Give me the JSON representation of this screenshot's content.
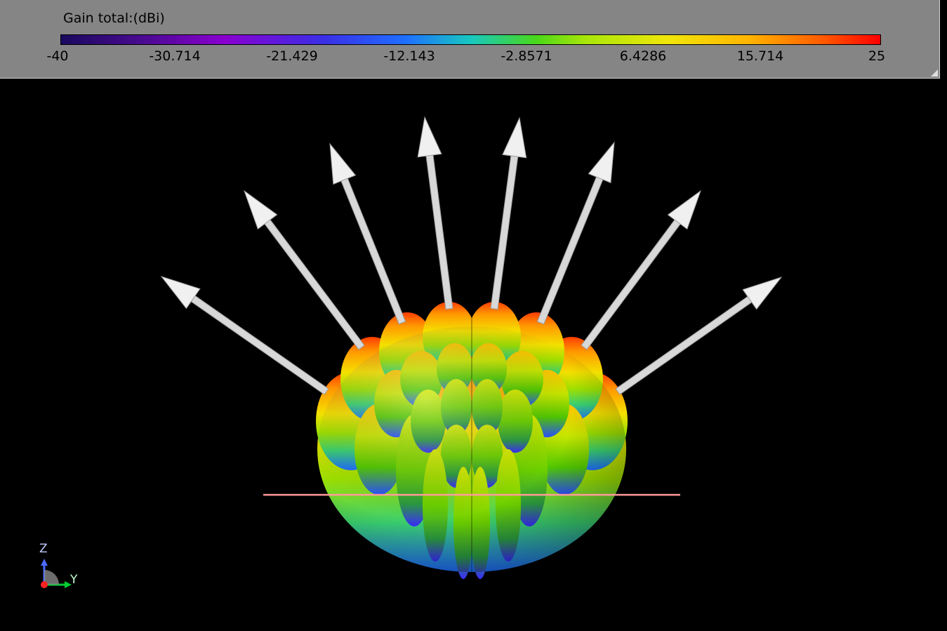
{
  "legend": {
    "title": "Gain total:(dBi)",
    "ticks": [
      "-40",
      "-30.714",
      "-21.429",
      "-12.143",
      "-2.8571",
      "6.4286",
      "15.714",
      "25"
    ]
  },
  "axes": {
    "z": "Z",
    "y": "Y",
    "colors": {
      "z": "#4a6aff",
      "y": "#00cc33",
      "origin": "#ff2222"
    }
  },
  "scene": {
    "beam_count": 8,
    "reference_line_color": "#ff9090",
    "arrow_color": "#e8e8e8"
  }
}
